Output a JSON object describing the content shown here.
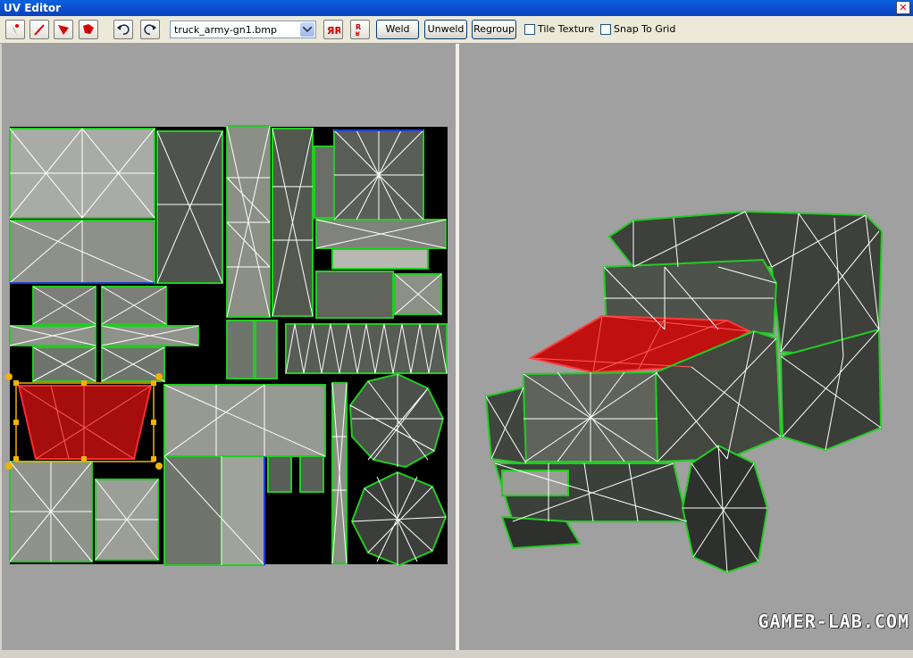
{
  "window": {
    "title": "UV Editor",
    "close_symbol": "✕"
  },
  "toolbar": {
    "texture_file": "truck_army-gn1.bmp",
    "weld_label": "Weld",
    "unweld_label": "Unweld",
    "regroup_label": "Regroup",
    "tile_texture_label": "Tile Texture",
    "tile_texture_checked": false,
    "snap_to_grid_label": "Snap To Grid",
    "snap_to_grid_checked": false,
    "icons": [
      "select-vertex-icon",
      "select-edge-icon",
      "select-face-icon",
      "select-group-icon",
      "undo-icon",
      "redo-icon",
      "mirror-horizontal-icon",
      "mirror-vertical-icon"
    ]
  },
  "uv_view": {
    "selection_color": "#d01010",
    "wire_color": "#22cc22",
    "edge_color": "#ffffff",
    "handle_color": "#f0b400"
  },
  "model_view": {
    "highlight_color": "#d01010"
  },
  "watermark": "GAMER-LAB.COM"
}
